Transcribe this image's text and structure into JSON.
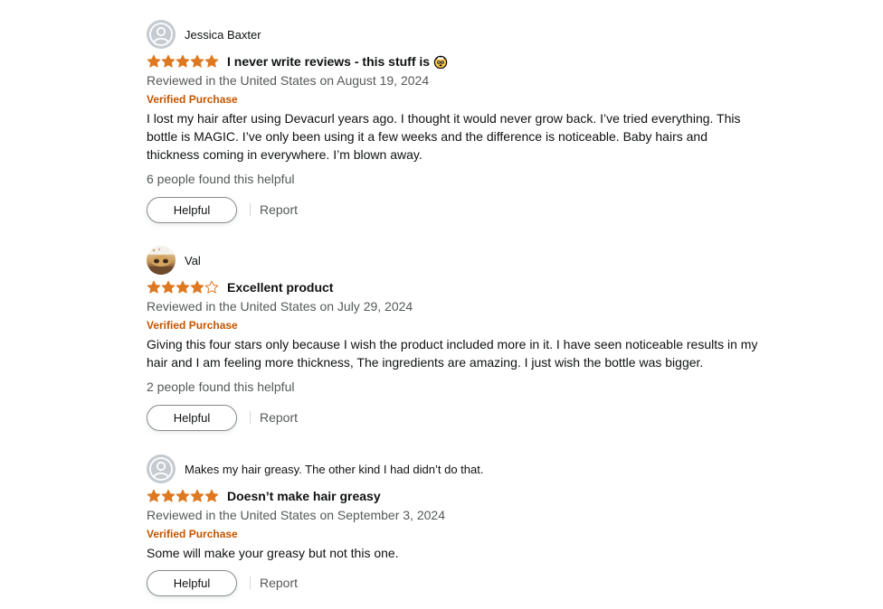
{
  "reviews": [
    {
      "reviewer": "Jessica Baxter",
      "avatar_icon": "default-user-icon",
      "rating": 5,
      "title": "I never write reviews - this stuff is",
      "title_emoji": "exploding-head-emoji",
      "date": "Reviewed in the United States on August 19, 2024",
      "verified": "Verified Purchase",
      "body": "I lost my hair after using Devacurl years ago. I thought it would never grow back. I’ve tried everything. This bottle is MAGIC. I’ve only been using it a few weeks and the difference is noticeable. Baby hairs and thickness coming in everywhere. I’m blown away.",
      "helpful_count": "6 people found this helpful",
      "helpful_label": "Helpful",
      "report_label": "Report"
    },
    {
      "reviewer": "Val",
      "avatar_icon": "profile-photo",
      "rating": 4,
      "title": "Excellent product",
      "date": "Reviewed in the United States on July 29, 2024",
      "verified": "Verified Purchase",
      "body": "Giving this four stars only because I wish the product included more in it. I have seen noticeable results in my hair and I am feeling more thickness, The ingredients are amazing. I just wish the bottle was bigger.",
      "helpful_count": "2 people found this helpful",
      "helpful_label": "Helpful",
      "report_label": "Report"
    },
    {
      "reviewer": "Makes my hair greasy. The other kind I had didn’t do that.",
      "avatar_icon": "default-user-icon",
      "rating": 5,
      "title": "Doesn’t make hair greasy",
      "date": "Reviewed in the United States on September 3, 2024",
      "verified": "Verified Purchase",
      "body": "Some will make your greasy but not this one.",
      "helpful_label": "Helpful",
      "report_label": "Report"
    }
  ],
  "colors": {
    "star_fill": "#de7921",
    "verified": "#c45500",
    "muted_text": "#565959",
    "text": "#0f1111"
  }
}
